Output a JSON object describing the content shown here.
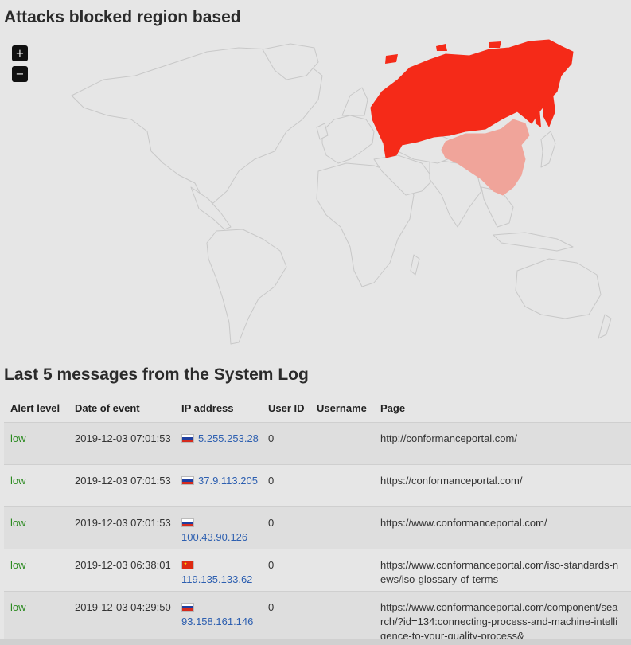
{
  "map": {
    "title": "Attacks blocked region based",
    "zoom_in": "+",
    "zoom_out": "−",
    "colors": {
      "land": "#e6e6e6",
      "border": "#c8c8c8",
      "russia": "#f52a18",
      "china": "#f0a49a"
    },
    "highlighted_regions": [
      {
        "name": "Russia",
        "intensity": "high"
      },
      {
        "name": "China",
        "intensity": "low"
      }
    ]
  },
  "log": {
    "title": "Last 5 messages from the System Log",
    "columns": [
      "Alert level",
      "Date of event",
      "IP address",
      "User ID",
      "Username",
      "Page"
    ],
    "rows": [
      {
        "alert": "low",
        "date": "2019-12-03 07:01:53",
        "flag": "ru",
        "ip": "5.255.253.28",
        "user_id": "0",
        "username": "",
        "page": "http://conformanceportal.com/"
      },
      {
        "alert": "low",
        "date": "2019-12-03 07:01:53",
        "flag": "ru",
        "ip": "37.9.113.205",
        "user_id": "0",
        "username": "",
        "page": "https://conformanceportal.com/"
      },
      {
        "alert": "low",
        "date": "2019-12-03 07:01:53",
        "flag": "ru",
        "ip": "100.43.90.126",
        "user_id": "0",
        "username": "",
        "page": "https://www.conformanceportal.com/"
      },
      {
        "alert": "low",
        "date": "2019-12-03 06:38:01",
        "flag": "cn",
        "ip": "119.135.133.62",
        "user_id": "0",
        "username": "",
        "page": "https://www.conformanceportal.com/iso-standards-news/iso-glossary-of-terms"
      },
      {
        "alert": "low",
        "date": "2019-12-03 04:29:50",
        "flag": "ru",
        "ip": "93.158.161.146",
        "user_id": "0",
        "username": "",
        "page": "https://www.conformanceportal.com/component/search/?id=134:connecting-process-and-machine-intelligence-to-your-quality-process&"
      }
    ]
  }
}
